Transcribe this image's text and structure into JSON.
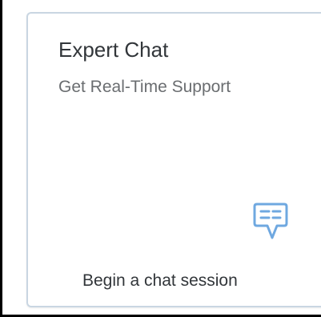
{
  "tile": {
    "title": "Expert Chat",
    "subtitle": "Get Real-Time Support",
    "footer": "Begin a chat session",
    "icon": "chat-bubble-icon"
  },
  "colors": {
    "icon": "#6fa8e0",
    "tile_border": "#c9d6e2",
    "title_text": "#32363a",
    "subtitle_text": "#6a6d70"
  }
}
